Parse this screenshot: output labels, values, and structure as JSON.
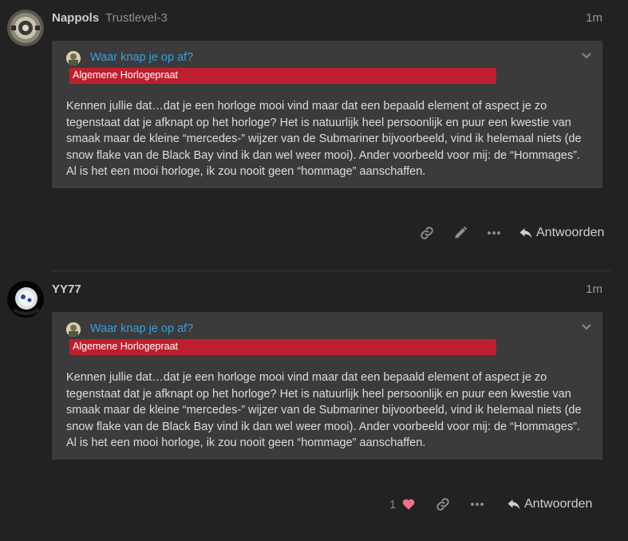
{
  "posts": [
    {
      "username": "Nappols",
      "user_title": "Trustlevel-3",
      "time": "1m",
      "quote_title": "Waar knap je op af?",
      "category": "Algemene Horlogepraat",
      "quote_text": "Kennen jullie dat…dat je een horloge mooi vind maar dat een bepaald element of aspect je zo tegenstaat dat je afknapt op het horloge? Het is natuurlijk heel persoonlijk en puur een kwestie van smaak maar de kleine “mercedes-” wijzer van de Submariner bijvoorbeeld, vind ik helemaal niets (de snow flake van de Black Bay vind ik dan wel weer mooi). Ander voorbeeld voor mij: de “Hommages”. Al is het een mooi horloge, ik zou nooit geen “hommage” aanschaffen.",
      "reply_label": "Antwoorden"
    },
    {
      "username": "YY77",
      "time": "1m",
      "quote_title": "Waar knap je op af?",
      "category": "Algemene Horlogepraat",
      "quote_text": "Kennen jullie dat…dat je een horloge mooi vind maar dat een bepaald element of aspect je zo tegenstaat dat je afknapt op het horloge? Het is natuurlijk heel persoonlijk en puur een kwestie van smaak maar de kleine “mercedes-” wijzer van de Submariner bijvoorbeeld, vind ik helemaal niets (de snow flake van de Black Bay vind ik dan wel weer mooi). Ander voorbeeld voor mij: de “Hommages”. Al is het een mooi horloge, ik zou nooit geen “hommage” aanschaffen.",
      "like_count": "1",
      "reply_label": "Antwoorden"
    }
  ],
  "icons": {
    "link": "link-icon",
    "edit": "pencil-icon",
    "more": "ellipsis-icon",
    "reply": "reply-icon",
    "like": "heart-icon",
    "expand": "chevron-down-icon"
  },
  "colors": {
    "background": "#222222",
    "quote_background": "#3b3b3b",
    "category": "#bf1e2e",
    "link": "#3a9fdf",
    "heart": "#f36f8c"
  }
}
